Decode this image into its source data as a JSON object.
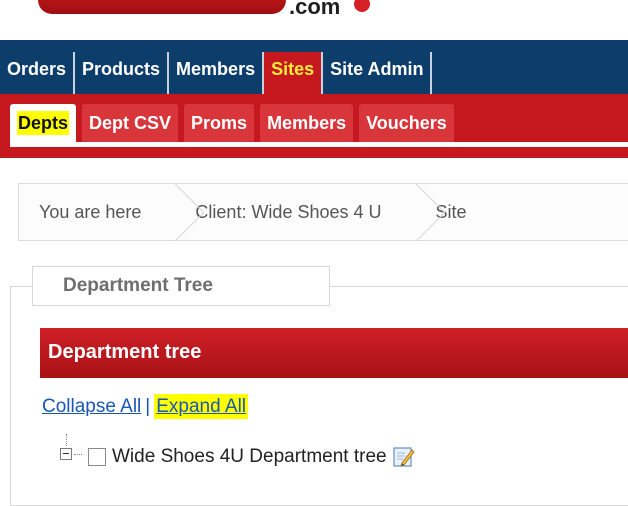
{
  "logo": {
    "text": ".com"
  },
  "main_nav": {
    "tabs": [
      {
        "label": "Orders",
        "active": false
      },
      {
        "label": "Products",
        "active": false
      },
      {
        "label": "Members",
        "active": false
      },
      {
        "label": "Sites",
        "active": true
      },
      {
        "label": "Site Admin",
        "active": false
      }
    ]
  },
  "sub_nav": {
    "tabs": [
      {
        "label": "Depts",
        "active": true
      },
      {
        "label": "Dept CSV",
        "active": false
      },
      {
        "label": "Proms",
        "active": false
      },
      {
        "label": "Members",
        "active": false
      },
      {
        "label": "Vouchers",
        "active": false
      }
    ]
  },
  "breadcrumb": {
    "items": [
      "You are here",
      "Client: Wide Shoes 4 U",
      "Site"
    ]
  },
  "section": {
    "legend": "Department Tree",
    "panel_title": "Department tree"
  },
  "tree_actions": {
    "collapse_label": "Collapse All",
    "separator": "|",
    "expand_label": "Expand All"
  },
  "tree": {
    "root_label": "Wide Shoes 4U Department tree",
    "expanded": true,
    "checked": false
  },
  "colors": {
    "main_nav_bg": "#0d3d6b",
    "accent_red": "#c5191f",
    "highlight_yellow": "#ffff00",
    "link_blue": "#1a56b6"
  },
  "icons": {
    "tree_toggle": "minus-box-icon",
    "edit": "edit-pencil-icon"
  }
}
